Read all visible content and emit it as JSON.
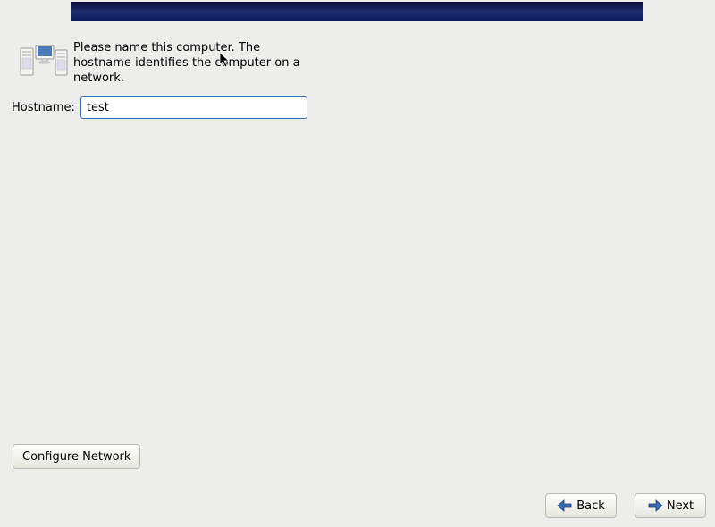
{
  "header": {
    "title": ""
  },
  "description": {
    "text": "Please name this computer.  The hostname identifies the computer on a network."
  },
  "hostname": {
    "label": "Hostname:",
    "value": "test"
  },
  "buttons": {
    "configure_network": "Configure Network",
    "back": "Back",
    "next": "Next"
  },
  "icons": {
    "computer": "computer-network-icon",
    "back_arrow": "arrow-left-icon",
    "next_arrow": "arrow-right-icon"
  }
}
